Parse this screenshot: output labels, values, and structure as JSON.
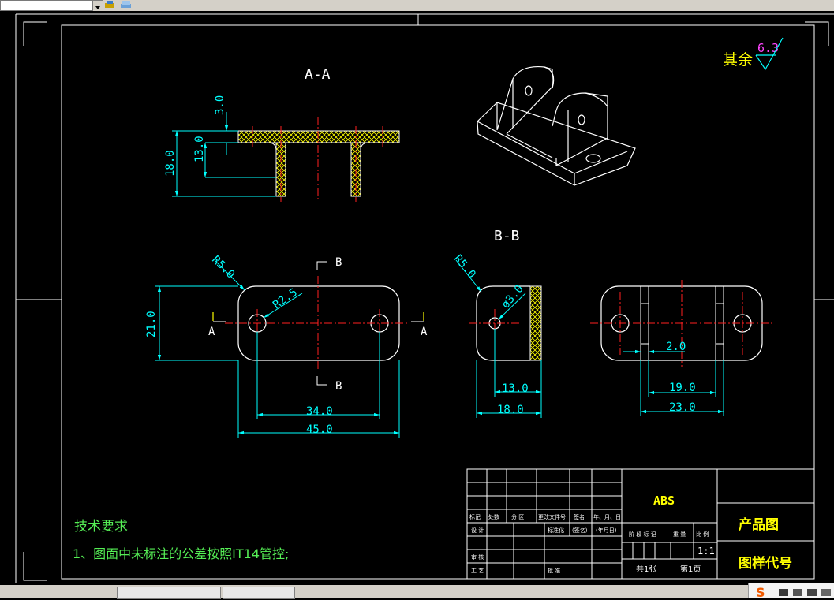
{
  "sections": {
    "a_a": "A-A",
    "b_b": "B-B"
  },
  "cut_marks": {
    "a_left": "A",
    "a_right": "A",
    "b_top": "B",
    "b_bottom": "B"
  },
  "roughness": {
    "label": "其余",
    "value": "6.3"
  },
  "dimensions": {
    "aa_3": "3.0",
    "aa_13": "13.0",
    "aa_18": "18.0",
    "plan_r5": "R5.0",
    "plan_r25": "R2.5",
    "plan_21": "21.0",
    "plan_34": "34.0",
    "plan_45": "45.0",
    "side_r5": "R5.0",
    "side_dia3": "ø3.0",
    "side_13": "13.0",
    "side_18": "18.0",
    "front_2": "2.0",
    "front_19": "19.0",
    "front_23": "23.0"
  },
  "notes": {
    "heading": "技术要求",
    "line1": "1、图面中未标注的公差按照IT14管控;"
  },
  "title_block": {
    "material": "ABS",
    "product": "产品图",
    "drawing_code": "图样代号",
    "scale": "1:1",
    "sheets": "共1张",
    "sheet_no": "第1页",
    "rev_headers": [
      "标记",
      "处数",
      "分 区",
      "更改文件号",
      "签名",
      "年、月、日"
    ],
    "role_design": "设 计",
    "role_std": "标准化",
    "role_sign": "(签名)",
    "role_date": "(年月日)",
    "role_review": "审 核",
    "role_process": "工 艺",
    "role_approve": "批 准",
    "stage_headers": [
      "阶 段 标 记",
      "重 量",
      "比 例"
    ]
  },
  "colors": {
    "background": "#000000",
    "line_white": "#ffffff",
    "dimension": "#00ffff",
    "centerline": "#ff2020",
    "hatch": "#ffff00",
    "notes": "#55ee55",
    "title_text": "#ffff00"
  }
}
